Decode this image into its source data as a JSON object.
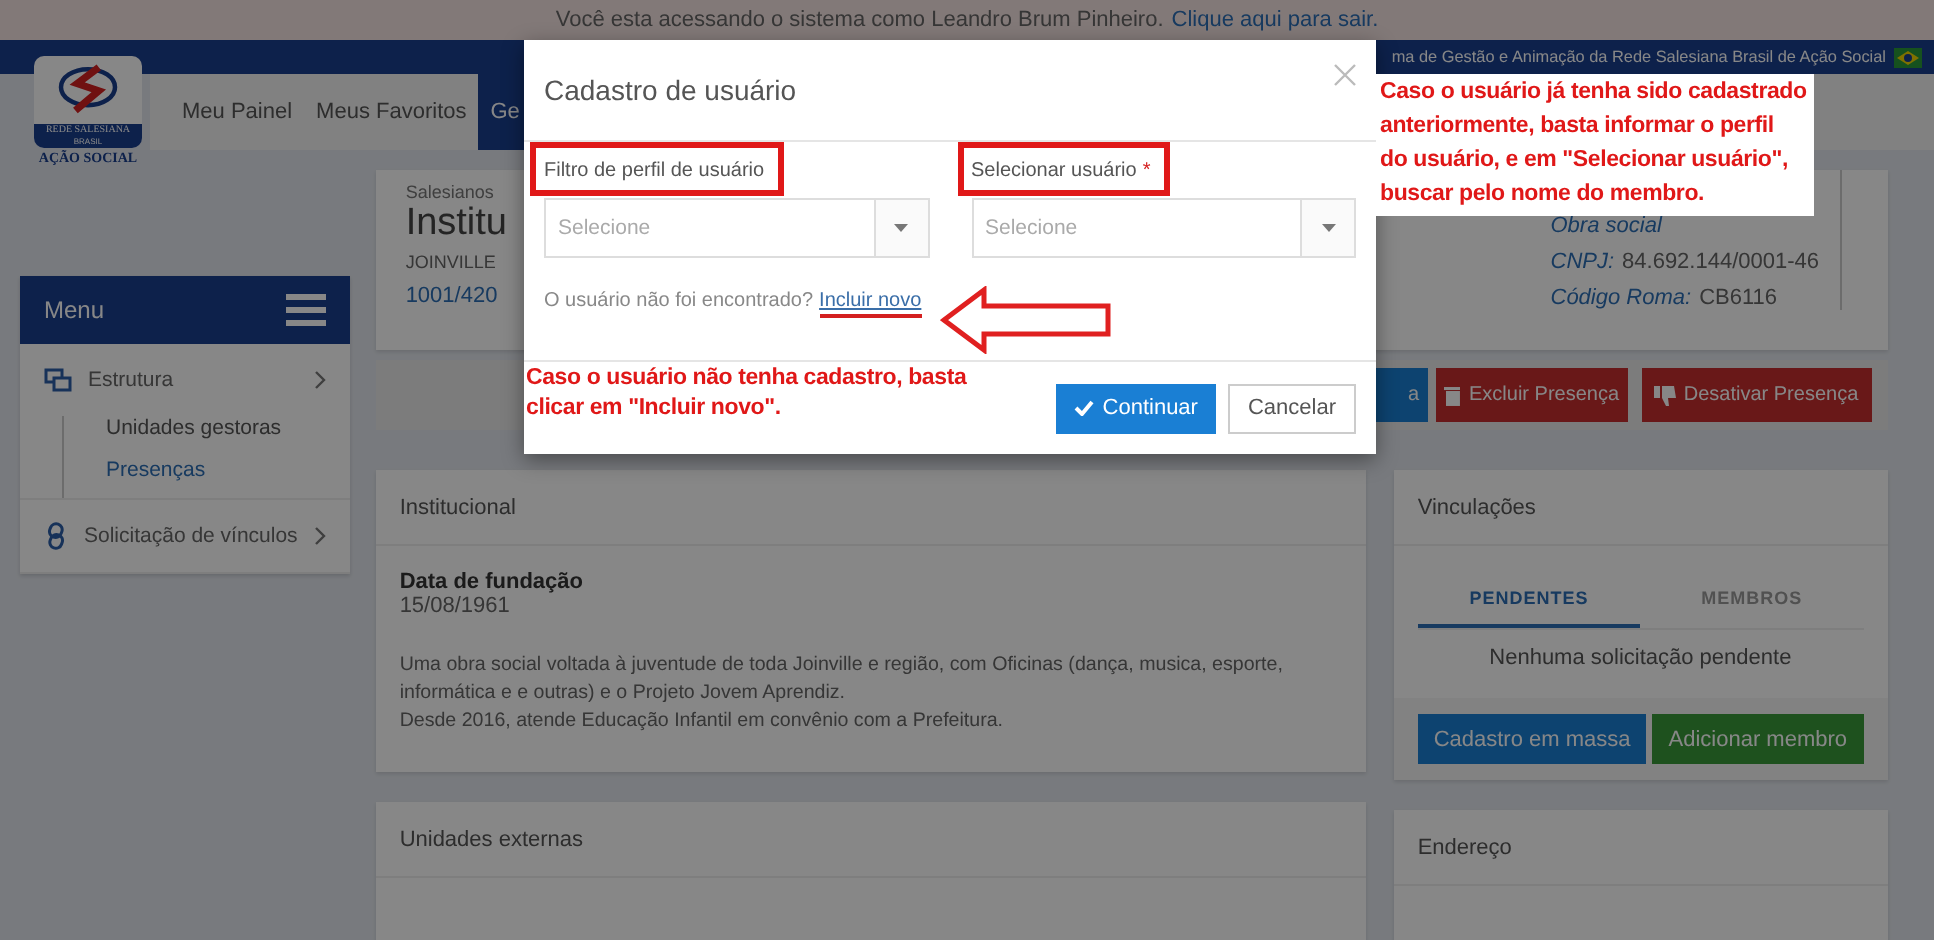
{
  "session_bar": {
    "text": "Você esta acessando o sistema como Leandro Brum Pinheiro.",
    "link": "Clique aqui para sair."
  },
  "header": {
    "system_name": "ma de Gestão e Animação da Rede Salesiana Brasil de Ação Social",
    "logo_lines": [
      "REDE SALESIANA",
      "BRASIL",
      "AÇÃO SOCIAL"
    ]
  },
  "nav": [
    {
      "label": "Meu Painel",
      "selected": false
    },
    {
      "label": "Meus Favoritos",
      "selected": false
    },
    {
      "label": "Ge",
      "selected": true
    }
  ],
  "sidebar": {
    "title": "Menu",
    "items": [
      {
        "label": "Estrutura",
        "children": [
          {
            "label": "Unidades gestoras",
            "selected": false
          },
          {
            "label": "Presenças",
            "selected": true
          }
        ]
      },
      {
        "label": "Solicitação de vínculos"
      }
    ]
  },
  "institution": {
    "breadcrumb": "Salesianos",
    "name": "Institu",
    "city": "JOINVILLE",
    "code": "1001/420",
    "type": "Obra social",
    "cnpj_label": "CNPJ:",
    "cnpj": "84.692.144/0001-46",
    "roma_label": "Código Roma:",
    "roma": "CB6116"
  },
  "actions": [
    {
      "label": "a",
      "kind": "primary"
    },
    {
      "label": "Excluir Presença",
      "kind": "delete"
    },
    {
      "label": "Desativar Presença",
      "kind": "deactivate"
    }
  ],
  "institutional": {
    "title": "Institucional",
    "founding_label": "Data de fundação",
    "founding_date": "15/08/1961",
    "description": [
      "Uma obra social voltada à juventude de toda Joinville e região, com Oficinas (dança, musica, esporte,",
      "informática e e outras) e o Projeto Jovem Aprendiz.",
      "Desde 2016, atende Educação Infantil em convênio com a Prefeitura."
    ]
  },
  "external_units": {
    "title": "Unidades externas"
  },
  "links_card": {
    "title": "Vinculações",
    "tabs": [
      {
        "label": "PENDENTES",
        "selected": true
      },
      {
        "label": "MEMBROS",
        "selected": false
      }
    ],
    "empty": "Nenhuma solicitação pendente",
    "buttons": [
      {
        "label": "Cadastro em massa",
        "kind": "primary"
      },
      {
        "label": "Adicionar membro",
        "kind": "success"
      }
    ]
  },
  "address": {
    "title": "Endereço"
  },
  "modal": {
    "title": "Cadastro de usuário",
    "fields": [
      {
        "label": "Filtro de perfil de usuário",
        "placeholder": "Selecione"
      },
      {
        "label": "Selecionar usuário",
        "required_mark": "*",
        "placeholder": "Selecione"
      }
    ],
    "not_found": "O usuário não foi encontrado?",
    "add_link": "Incluir novo",
    "buttons": [
      {
        "label": "Continuar",
        "kind": "primary"
      },
      {
        "label": "Cancelar",
        "kind": "default"
      }
    ]
  },
  "annotations": [
    {
      "lines": [
        "Caso o usuário já tenha sido cadastrado",
        "anteriormente, basta informar o perfil",
        "do usuário, e em \"Selecionar usuário\",",
        "buscar pelo nome do membro."
      ]
    },
    {
      "lines": [
        "Caso o usuário não tenha cadastro, basta",
        "clicar em \"Incluir novo\"."
      ]
    }
  ]
}
